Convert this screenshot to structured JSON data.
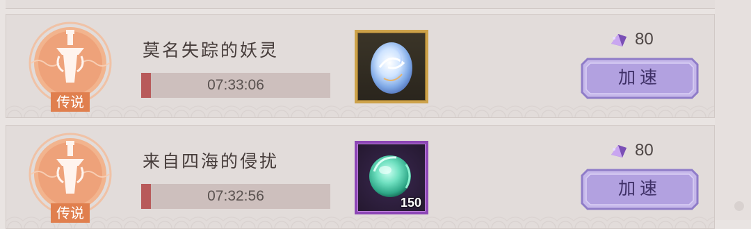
{
  "quests": [
    {
      "title": "莫名失踪的妖灵",
      "rarity_label": "传说",
      "timer": "07:33:06",
      "timer_progress": 0.05,
      "reward_icon": "blue-spirit-orb-icon",
      "reward_frame_color": "#cda24a",
      "reward_quantity": "",
      "cost_icon": "purple-crystal-icon",
      "cost": "80",
      "speed_up_label": "加速"
    },
    {
      "title": "来自四海的侵扰",
      "rarity_label": "传说",
      "timer": "07:32:56",
      "timer_progress": 0.05,
      "reward_icon": "green-spirit-orb-icon",
      "reward_frame_color": "#8c46b5",
      "reward_quantity": "150",
      "cost_icon": "purple-crystal-icon",
      "cost": "80",
      "speed_up_label": "加速"
    }
  ],
  "colors": {
    "emblem": "#e8956a",
    "timer_fill": "#b85a5a",
    "button": "#b6a6df"
  }
}
